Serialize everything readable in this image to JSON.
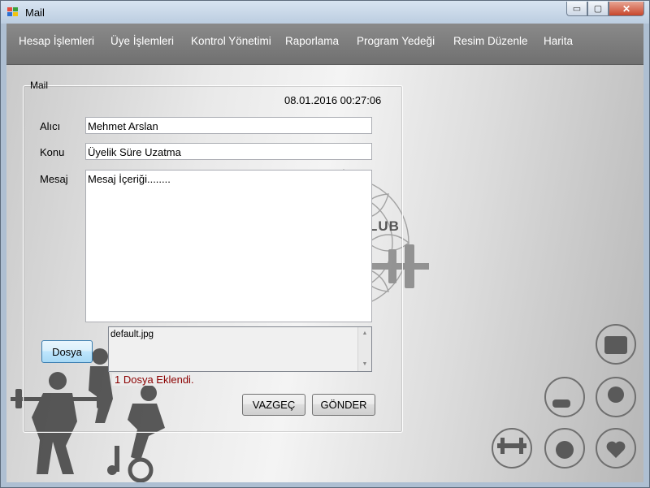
{
  "window": {
    "title": "Mail",
    "min_glyph": "▭",
    "max_glyph": "▢",
    "close_glyph": "✕"
  },
  "menu": [
    "Hesap İşlemleri",
    "Üye İşlemleri",
    "Kontrol Yönetimi",
    "Raporlama",
    "Program Yedeği",
    "Resim Düzenle",
    "Harita"
  ],
  "mail_group": {
    "legend": "Mail",
    "datetime": "08.01.2016 00:27:06",
    "recipient_label": "Alıcı",
    "recipient_value": "Mehmet Arslan",
    "subject_label": "Konu",
    "subject_value": "Üyelik Süre Uzatma",
    "message_label": "Mesaj",
    "message_value": "Mesaj İçeriği........",
    "file_button": "Dosya",
    "attachments": [
      "default.jpg"
    ],
    "attach_status": "1 Dosya Eklendi.",
    "cancel_button": "VAZGEÇ",
    "send_button": "GÖNDER"
  },
  "background": {
    "club_text": "LUB"
  },
  "colors": {
    "menu_bg": "#7a7a7a",
    "status_text": "#8b0000",
    "focus_border": "#3c7fb1"
  },
  "icons": [
    "scale-icon",
    "exercise-bike-icon",
    "weight-scale-icon",
    "dumbbell-icon",
    "nutrition-icon",
    "heart-monitor-icon"
  ]
}
